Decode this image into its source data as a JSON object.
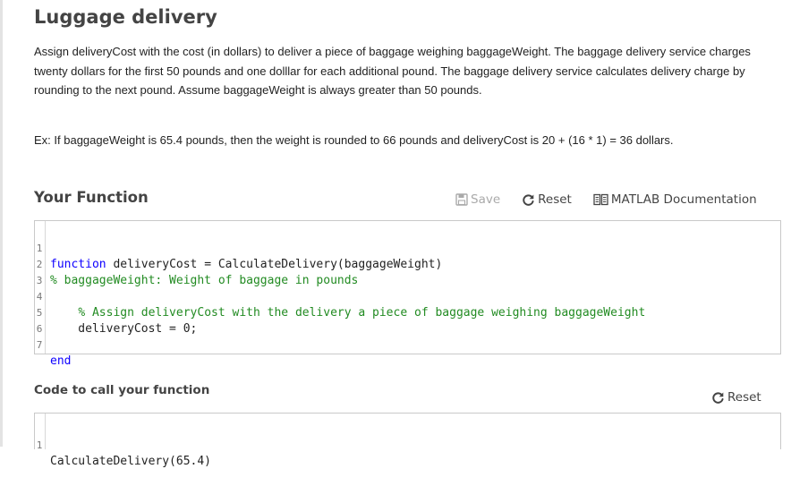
{
  "problem": {
    "title": "Luggage delivery",
    "description": "Assign deliveryCost with the cost (in dollars) to deliver a piece of baggage weighing baggageWeight. The baggage delivery service charges twenty dollars for the first 50 pounds and one dolllar for each additional pound. The baggage delivery service calculates delivery charge by rounding to the next pound. Assume baggageWeight is always greater than 50 pounds.",
    "example": "Ex: If baggageWeight is 65.4 pounds, then the weight is rounded to 66 pounds and deliveryCost is 20 + (16 * 1) = 36 dollars."
  },
  "function_section": {
    "heading": "Your Function",
    "toolbar": {
      "save_label": "Save",
      "reset_label": "Reset",
      "docs_label": "MATLAB Documentation"
    },
    "code_lines": [
      {
        "num": "1",
        "keyword": "function",
        "text": " deliveryCost = CalculateDelivery(baggageWeight)",
        "comment": ""
      },
      {
        "num": "2",
        "keyword": "",
        "text": "",
        "comment": "% baggageWeight: Weight of baggage in pounds"
      },
      {
        "num": "3",
        "keyword": "",
        "text": "",
        "comment": ""
      },
      {
        "num": "4",
        "keyword": "",
        "text": "    ",
        "comment": "% Assign deliveryCost with the delivery a piece of baggage weighing baggageWeight"
      },
      {
        "num": "5",
        "keyword": "",
        "text": "    deliveryCost = 0;",
        "comment": ""
      },
      {
        "num": "6",
        "keyword": "",
        "text": "",
        "comment": ""
      },
      {
        "num": "7",
        "keyword": "end",
        "text": "",
        "comment": ""
      }
    ]
  },
  "call_section": {
    "heading": "Code to call your function",
    "reset_label": "Reset",
    "code_lines": [
      {
        "num": "1",
        "text": "CalculateDelivery(65.4)"
      }
    ]
  },
  "colors": {
    "keyword": "#0e00ff",
    "comment": "#228b22",
    "disabled": "#aaaaaa"
  }
}
